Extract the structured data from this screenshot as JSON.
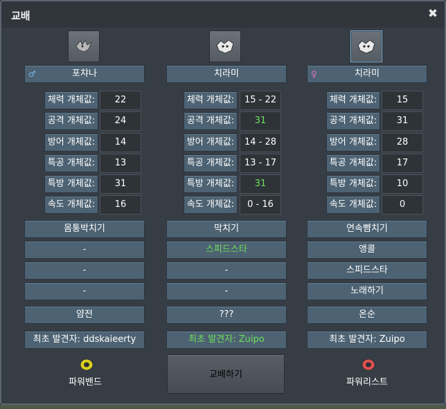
{
  "window": {
    "title": "교배",
    "close": "✖"
  },
  "parents": [
    {
      "gender": "♂",
      "gender_class": "g-male",
      "name": "포챠나",
      "stats": [
        {
          "label": "체력 개체값:",
          "value": "22",
          "green": false
        },
        {
          "label": "공격 개체값:",
          "value": "24",
          "green": false
        },
        {
          "label": "방어 개체값:",
          "value": "14",
          "green": false
        },
        {
          "label": "특공 개체값:",
          "value": "13",
          "green": false
        },
        {
          "label": "특방 개체값:",
          "value": "31",
          "green": false
        },
        {
          "label": "속도 개체값:",
          "value": "16",
          "green": false
        }
      ],
      "moves": [
        {
          "label": "몸통박치기",
          "green": false
        },
        {
          "label": "-",
          "green": false
        },
        {
          "label": "-",
          "green": false
        },
        {
          "label": "-",
          "green": false
        }
      ],
      "nature": "얌전",
      "discoverer": {
        "text": "최초 발견자: ddskaieerty",
        "green": false
      },
      "item": {
        "label": "파워밴드",
        "icon": "power-band-icon",
        "color": "#d8d020"
      }
    },
    {
      "gender": "",
      "gender_class": "",
      "name": "치라미",
      "stats": [
        {
          "label": "체력 개체값:",
          "value": "15 - 22",
          "green": false
        },
        {
          "label": "공격 개체값:",
          "value": "31",
          "green": true
        },
        {
          "label": "방어 개체값:",
          "value": "14 - 28",
          "green": false
        },
        {
          "label": "특공 개체값:",
          "value": "13 - 17",
          "green": false
        },
        {
          "label": "특방 개체값:",
          "value": "31",
          "green": true
        },
        {
          "label": "속도 개체값:",
          "value": "0 - 16",
          "green": false
        }
      ],
      "moves": [
        {
          "label": "막치기",
          "green": false
        },
        {
          "label": "스피드스타",
          "green": true
        },
        {
          "label": "-",
          "green": false
        },
        {
          "label": "-",
          "green": false
        }
      ],
      "nature": "???",
      "discoverer": {
        "text": "최초 발견자: Zuipo",
        "green": true
      }
    },
    {
      "gender": "♀",
      "gender_class": "g-female",
      "name": "치라미",
      "stats": [
        {
          "label": "체력 개체값:",
          "value": "15",
          "green": false
        },
        {
          "label": "공격 개체값:",
          "value": "31",
          "green": false
        },
        {
          "label": "방어 개체값:",
          "value": "28",
          "green": false
        },
        {
          "label": "특공 개체값:",
          "value": "17",
          "green": false
        },
        {
          "label": "특방 개체값:",
          "value": "10",
          "green": false
        },
        {
          "label": "속도 개체값:",
          "value": "0",
          "green": false
        }
      ],
      "moves": [
        {
          "label": "연속뺨치기",
          "green": false
        },
        {
          "label": "앵콜",
          "green": false
        },
        {
          "label": "스피드스타",
          "green": false
        },
        {
          "label": "노래하기",
          "green": false
        }
      ],
      "nature": "온순",
      "discoverer": {
        "text": "최초 발견자: Zuipo",
        "green": false
      },
      "item": {
        "label": "파워리스트",
        "icon": "power-wrist-icon",
        "color": "#e05050"
      }
    }
  ],
  "trade_button": "교배하기"
}
